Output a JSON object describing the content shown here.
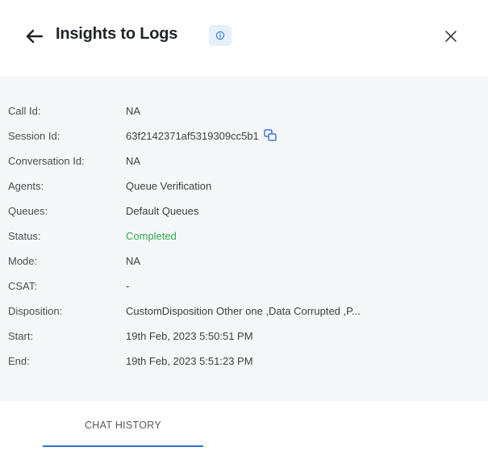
{
  "header": {
    "title": "Insights to Logs",
    "back_icon": "arrow-left-icon",
    "info_icon": "info-icon",
    "close_icon": "close-icon"
  },
  "details": [
    {
      "label": "Call Id:",
      "value": "NA"
    },
    {
      "label": "Session Id:",
      "value": "63f2142371af5319309cc5b1",
      "copy_icon": "copy-icon"
    },
    {
      "label": "Conversation Id:",
      "value": "NA"
    },
    {
      "label": "Agents:",
      "value": "Queue Verification"
    },
    {
      "label": "Queues:",
      "value": "Default Queues"
    },
    {
      "label": "Status:",
      "value": "Completed",
      "color": "#2eaa4f"
    },
    {
      "label": "Mode:",
      "value": "NA"
    },
    {
      "label": "CSAT:",
      "value": "-"
    },
    {
      "label": "Disposition:",
      "value": "CustomDisposition Other one ,Data Corrupted ,P..."
    },
    {
      "label": "Start:",
      "value": "19th Feb, 2023 5:50:51 PM"
    },
    {
      "label": "End:",
      "value": "19th Feb, 2023 5:51:23 PM"
    }
  ],
  "tabs": [
    {
      "label": "CHAT HISTORY",
      "active": true
    }
  ],
  "colors": {
    "accent": "#2f6fc9",
    "panel_bg": "#f6f7f9",
    "status_completed": "#2eaa4f",
    "info_badge_bg": "#e6f0fb"
  }
}
